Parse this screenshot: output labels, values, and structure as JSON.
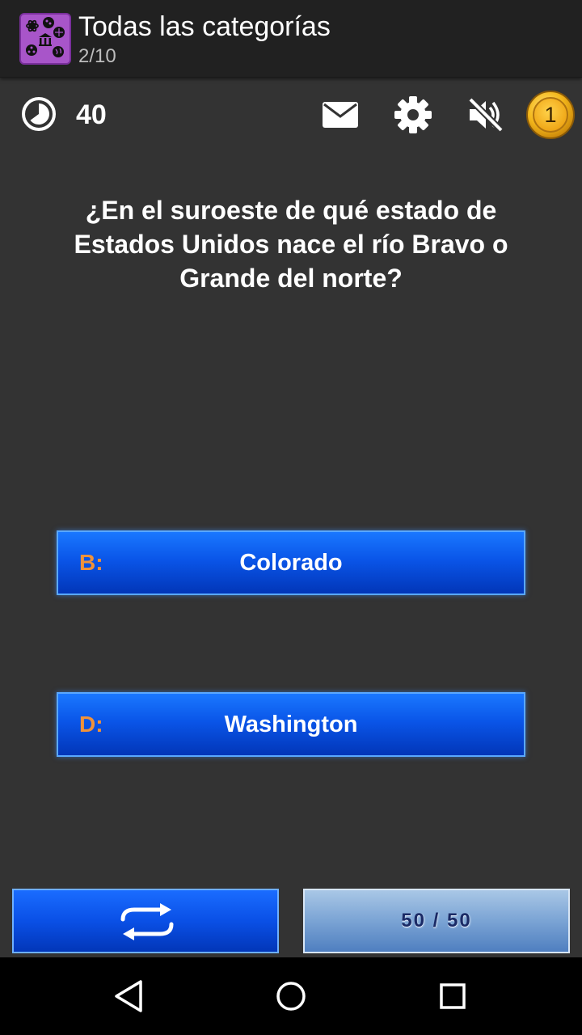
{
  "app_bar": {
    "title": "Todas las categorías",
    "progress": "2/10",
    "icon": "categories-app-icon"
  },
  "toolbar": {
    "timer_icon": "timer-icon",
    "timer_value": "40",
    "mail_icon": "mail-icon",
    "settings_icon": "gear-icon",
    "sound_icon": "volume-off-icon",
    "coins": "1"
  },
  "question": {
    "text": "¿En el suroeste de qué estado de Estados Unidos nace el río Bravo o Grande del norte?"
  },
  "answers": [
    {
      "letter": "B:",
      "text": "Colorado"
    },
    {
      "letter": "D:",
      "text": "Washington"
    }
  ],
  "bottom_buttons": {
    "switch_icon": "swap-arrows-icon",
    "fifty_label": "50 / 50"
  },
  "navbar": {
    "back_icon": "back-triangle-icon",
    "home_icon": "home-circle-icon",
    "recents_icon": "recents-square-icon"
  },
  "colors": {
    "background": "#333333",
    "app_bar": "#212121",
    "answer_blue": "#0a55e8",
    "answer_letter": "#f0923a",
    "coin_gold": "#f4b81c"
  }
}
